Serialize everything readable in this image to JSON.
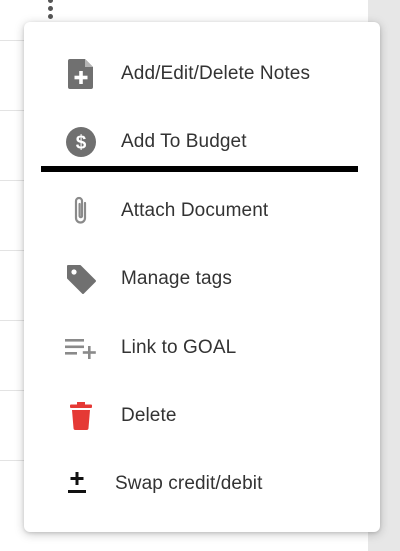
{
  "menu": {
    "items": [
      {
        "label": "Add/Edit/Delete Notes",
        "icon": "note-add-icon",
        "color": "#707070"
      },
      {
        "label": "Add To Budget",
        "icon": "dollar-circle-icon",
        "color": "#707070"
      },
      {
        "label": "Attach Document",
        "icon": "paperclip-icon",
        "color": "#8a8a8a"
      },
      {
        "label": "Manage tags",
        "icon": "tag-icon",
        "color": "#707070"
      },
      {
        "label": "Link to GOAL",
        "icon": "playlist-add-icon",
        "color": "#8a8a8a"
      },
      {
        "label": "Delete",
        "icon": "trash-icon",
        "color": "#e53935"
      },
      {
        "label": "Swap credit/debit",
        "icon": "plus-minus-icon",
        "color": "#111111"
      }
    ]
  }
}
